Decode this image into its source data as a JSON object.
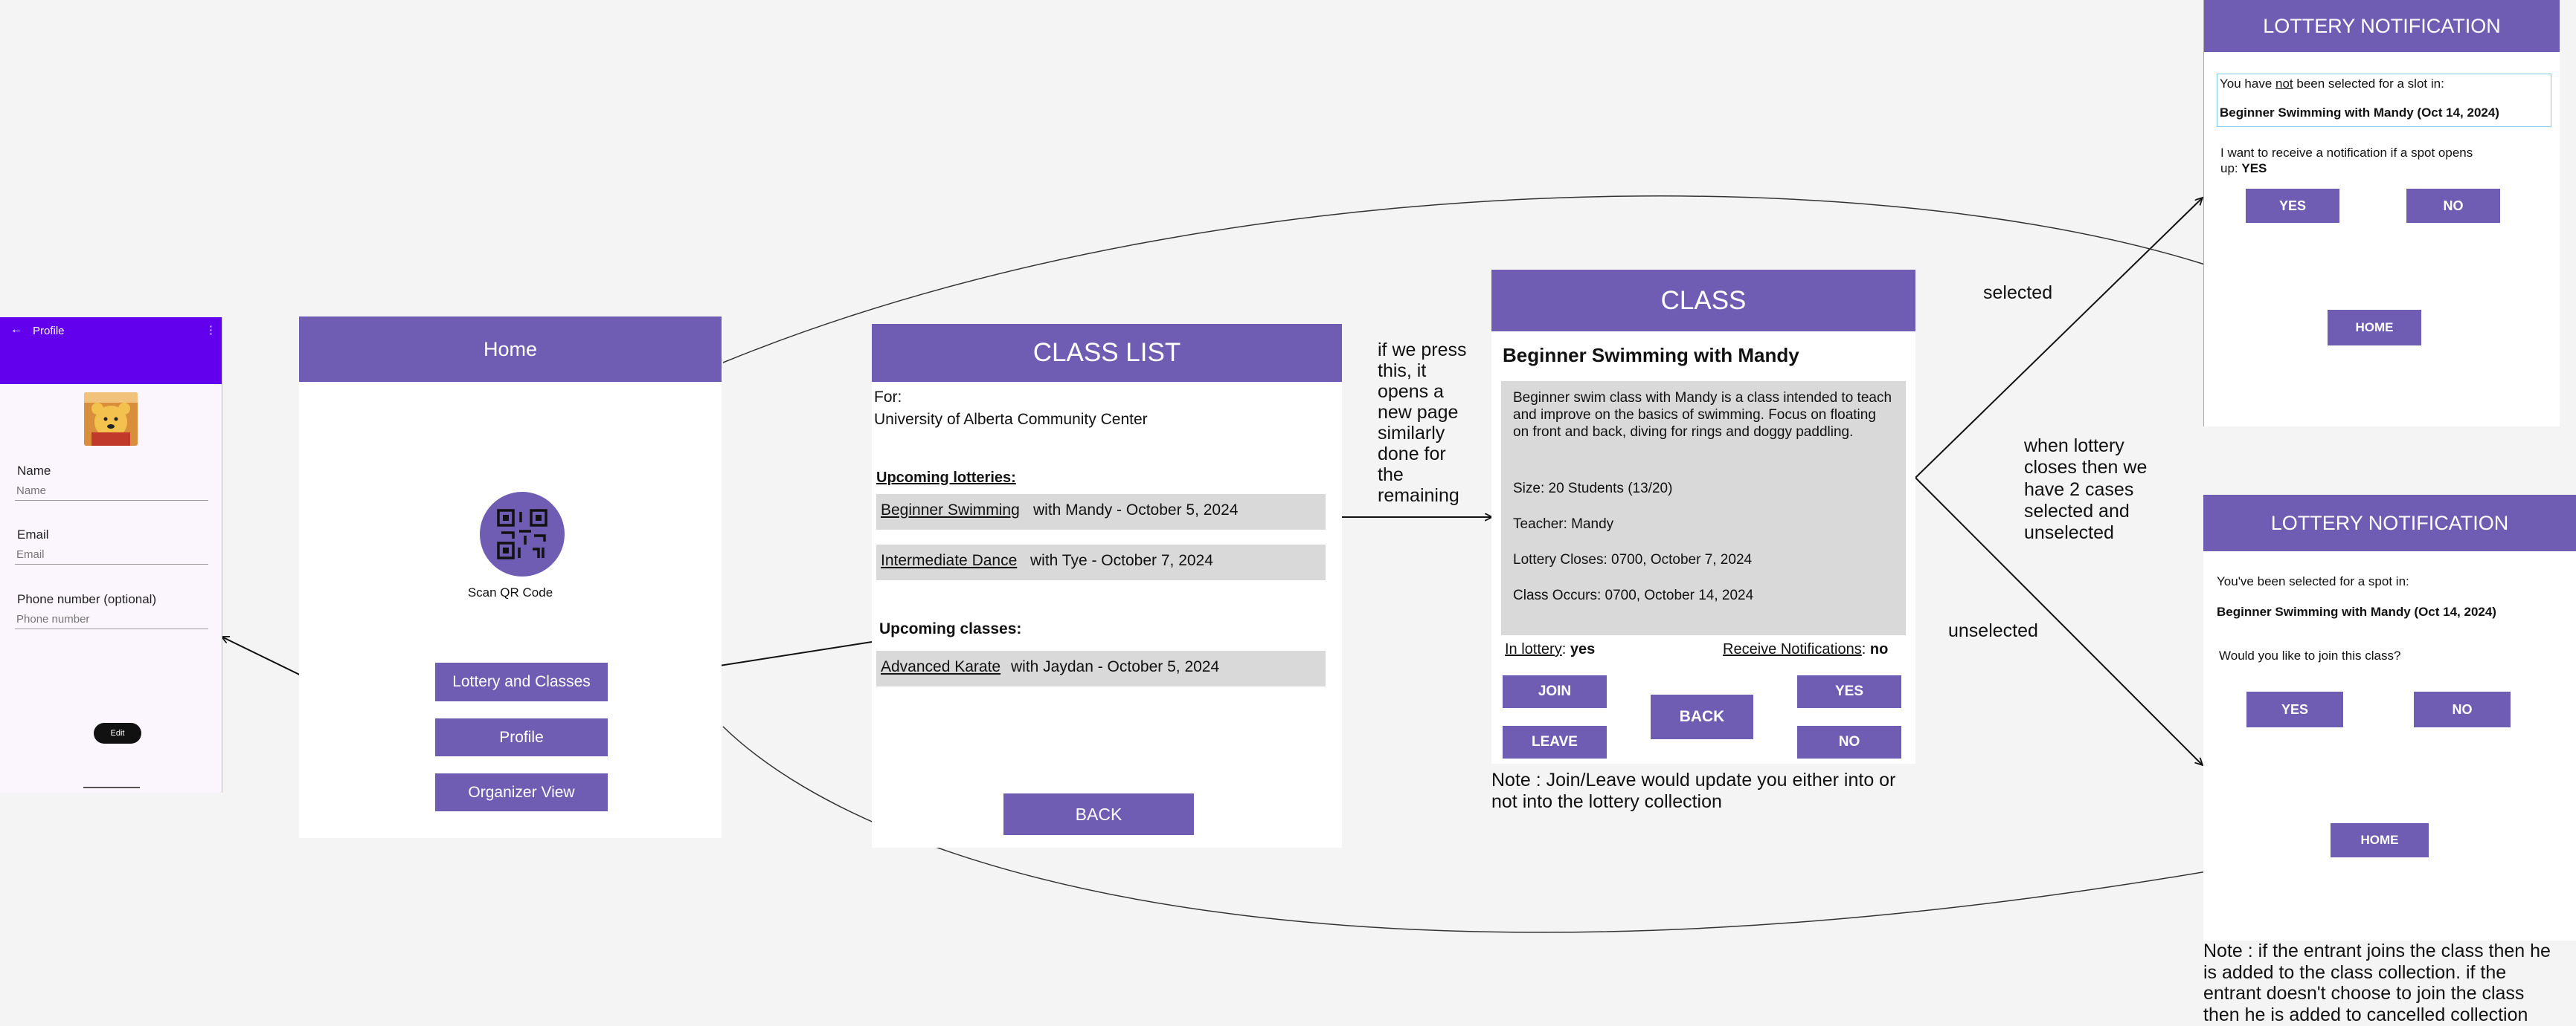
{
  "profile_screen": {
    "title": "Profile",
    "back_icon": "←",
    "menu_icon": "⋮",
    "name_label": "Name",
    "name_placeholder": "Name",
    "email_label": "Email",
    "email_placeholder": "Email",
    "phone_label": "Phone number (optional)",
    "phone_placeholder": "Phone number",
    "edit_button": "Edit",
    "colors": {
      "header": "#6200ee",
      "background": "#fbf6fd"
    }
  },
  "home_screen": {
    "title": "Home",
    "qr_label": "Scan QR Code",
    "buttons": [
      "Lottery and Classes",
      "Profile",
      "Organizer View"
    ]
  },
  "class_list_screen": {
    "title": "CLASS LIST",
    "for_label": "For:",
    "location": "University of Alberta Community Center",
    "lotteries_heading": "Upcoming lotteries:",
    "lotteries": [
      {
        "name": "Beginner Swimming",
        "detail": " with Mandy - October 5, 2024"
      },
      {
        "name": "Intermediate Dance",
        "detail": " with Tye - October 7, 2024"
      }
    ],
    "classes_heading": "Upcoming classes:",
    "classes": [
      {
        "name": "Advanced Karate",
        "detail": " with Jaydan - October 5, 2024"
      }
    ],
    "back_button": "BACK"
  },
  "annotations": {
    "press_note": "if we press\nthis, it\nopens a\nnew page\nsimilarly\ndone for\nthe\nremaining",
    "join_leave_note": "Note : Join/Leave would update you either into or\nnot into the lottery collection",
    "selected_label": "selected",
    "lottery_closes_note": "when lottery\ncloses then we\nhave 2 cases\nselected and\nunselected",
    "unselected_label": "unselected",
    "entrant_note": "Note : if the entrant joins the class then he\nis added to the class collection. if the\nentrant doesn't choose to join the class\nthen he is added to cancelled collection"
  },
  "class_screen": {
    "title": "CLASS",
    "class_name": "Beginner Swimming with Mandy",
    "description": "Beginner swim class with Mandy is a class intended to teach and improve on the basics of swimming. Focus on floating on front and back, diving for rings and doggy paddling.",
    "size": "Size: 20 Students (13/20)",
    "teacher": "Teacher: Mandy",
    "lottery_closes": "Lottery Closes: 0700, October 7, 2024",
    "class_occurs": "Class Occurs: 0700, October 14, 2024",
    "in_lottery_label": "In lottery",
    "in_lottery_value": "yes",
    "notif_label": "Receive Notifications",
    "notif_value": "no",
    "join_button": "JOIN",
    "leave_button": "LEAVE",
    "back_button": "BACK",
    "yes_button": "YES",
    "no_button": "NO"
  },
  "notification_not_selected": {
    "title": "LOTTERY NOTIFICATION",
    "line_pre": "You have ",
    "line_not": "not",
    "line_post": " been selected for a slot in:",
    "class_name": "Beginner Swimming with Mandy (Oct 14, 2024)",
    "question": "I want to receive a notification if a spot opens\nup: ",
    "answer": "YES",
    "yes_button": "YES",
    "no_button": "NO",
    "home_button": "HOME"
  },
  "notification_selected": {
    "title": "LOTTERY NOTIFICATION",
    "line": "You've been selected for a spot in:",
    "class_name": "Beginner Swimming with Mandy (Oct 14, 2024)",
    "question": "Would you like to join this class?",
    "yes_button": "YES",
    "no_button": "NO",
    "home_button": "HOME"
  },
  "colors": {
    "accent": "#6e5db3",
    "grey_box": "#d9d9d9",
    "canvas": "#f4f4f4"
  }
}
